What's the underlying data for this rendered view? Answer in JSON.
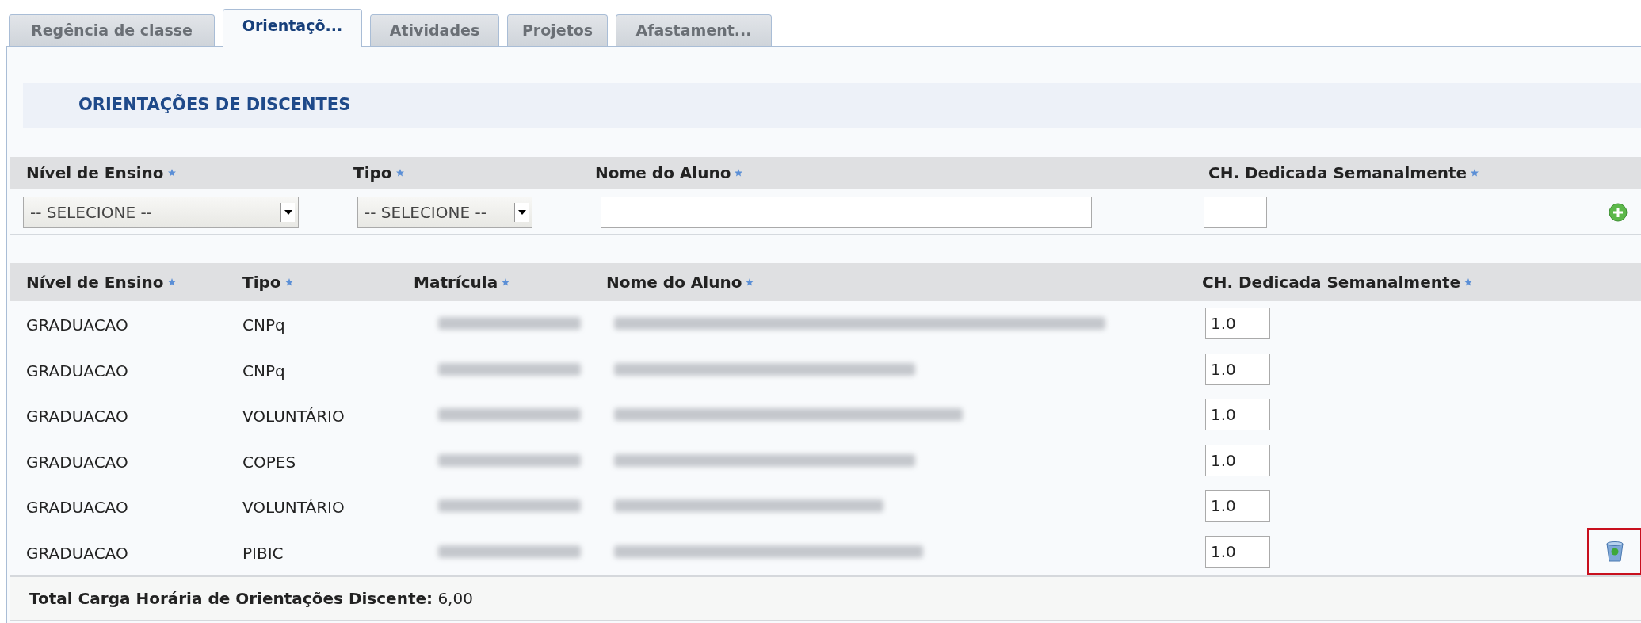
{
  "tabs": [
    {
      "label": "Regência de classe",
      "selected": false
    },
    {
      "label": "Orientaçõ...",
      "selected": true
    },
    {
      "label": "Atividades",
      "selected": false
    },
    {
      "label": "Projetos",
      "selected": false
    },
    {
      "label": "Afastament...",
      "selected": false
    }
  ],
  "section_title": "ORIENTAÇÕES DE DISCENTES",
  "form": {
    "columns": [
      "Nível de Ensino",
      "Tipo",
      "Nome do Aluno",
      "CH. Dedicada Semanalmente"
    ],
    "nivel_select": "-- SELECIONE --",
    "tipo_select": "-- SELECIONE --"
  },
  "table": {
    "columns": [
      "Nível de Ensino",
      "Tipo",
      "Matrícula",
      "Nome do Aluno",
      "CH. Dedicada Semanalmente"
    ],
    "rows": [
      {
        "nivel": "GRADUACAO",
        "tipo": "CNPq",
        "redacted": true,
        "ch": "1.0"
      },
      {
        "nivel": "GRADUACAO",
        "tipo": "CNPq",
        "redacted": true,
        "ch": "1.0"
      },
      {
        "nivel": "GRADUACAO",
        "tipo": "VOLUNTÁRIO",
        "redacted": true,
        "ch": "1.0"
      },
      {
        "nivel": "GRADUACAO",
        "tipo": "COPES",
        "redacted": true,
        "ch": "1.0"
      },
      {
        "nivel": "GRADUACAO",
        "tipo": "VOLUNTÁRIO",
        "redacted": true,
        "ch": "1.0"
      },
      {
        "nivel": "GRADUACAO",
        "tipo": "PIBIC",
        "redacted": true,
        "ch": "1.0",
        "delete": {
          "highlighted": true
        }
      }
    ]
  },
  "total": "**Total Carga Horária de Orientações Discente:** 6,00"
}
